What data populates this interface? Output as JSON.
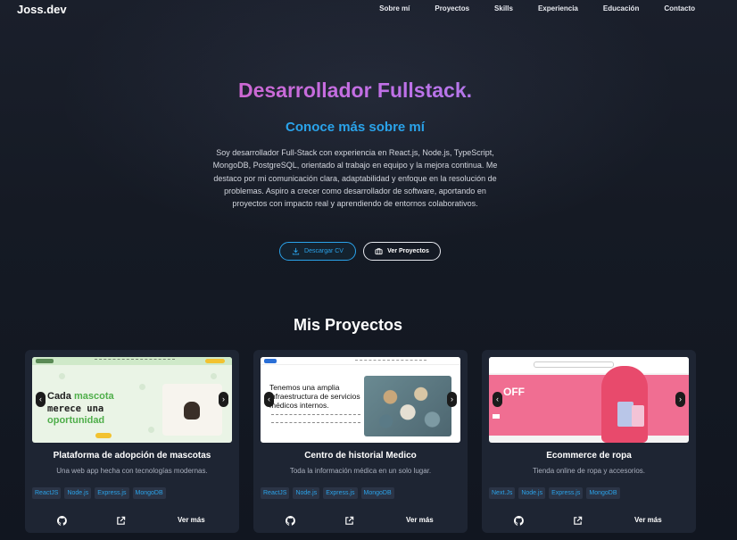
{
  "nav": {
    "brand": "Joss.dev",
    "links": [
      "Sobre mí",
      "Proyectos",
      "Skills",
      "Experiencia",
      "Educación",
      "Contacto"
    ]
  },
  "hero": {
    "title": "Desarrollador Fullstack.",
    "subtitle": "Conoce más sobre mí",
    "description": "Soy desarrollador Full-Stack con experiencia en React.js, Node.js, TypeScript, MongoDB, PostgreSQL, orientado al trabajo en equipo y la mejora continua. Me destaco por mi comunicación clara, adaptabilidad y enfoque en la resolución de problemas. Aspiro a crecer como desarrollador de software, aportando en proyectos con impacto real y aprendiendo de entornos colaborativos.",
    "cv_button": "Descargar CV",
    "projects_button": "Ver Proyectos",
    "accent_color": "#2aa3ea"
  },
  "projects": {
    "title": "Mis Proyectos",
    "cards": [
      {
        "title": "Plataforma de adopción de mascotas",
        "description": "Una web app hecha con tecnologías modernas.",
        "tags": [
          "ReactJS",
          "Node.js",
          "Express.js",
          "MongoDB"
        ],
        "more": "Ver más",
        "thumb": {
          "heading_1": "Cada",
          "heading_2": "mascota",
          "heading_3": "merece una",
          "heading_4": "oportunidad"
        }
      },
      {
        "title": "Centro de historial Medico",
        "description": "Toda la información médica en un solo lugar.",
        "tags": [
          "ReactJS",
          "Node.js",
          "Express.js",
          "MongoDB"
        ],
        "more": "Ver más",
        "thumb": {
          "heading": "Tenemos una amplia infraestructura de servicios médicos internos."
        }
      },
      {
        "title": "Ecommerce de ropa",
        "description": "Tienda online de ropa y accesorios.",
        "tags": [
          "Next.Js",
          "Node.js",
          "Express.js",
          "MongoDB"
        ],
        "more": "Ver más",
        "thumb": {
          "heading": "OFF"
        }
      }
    ]
  }
}
